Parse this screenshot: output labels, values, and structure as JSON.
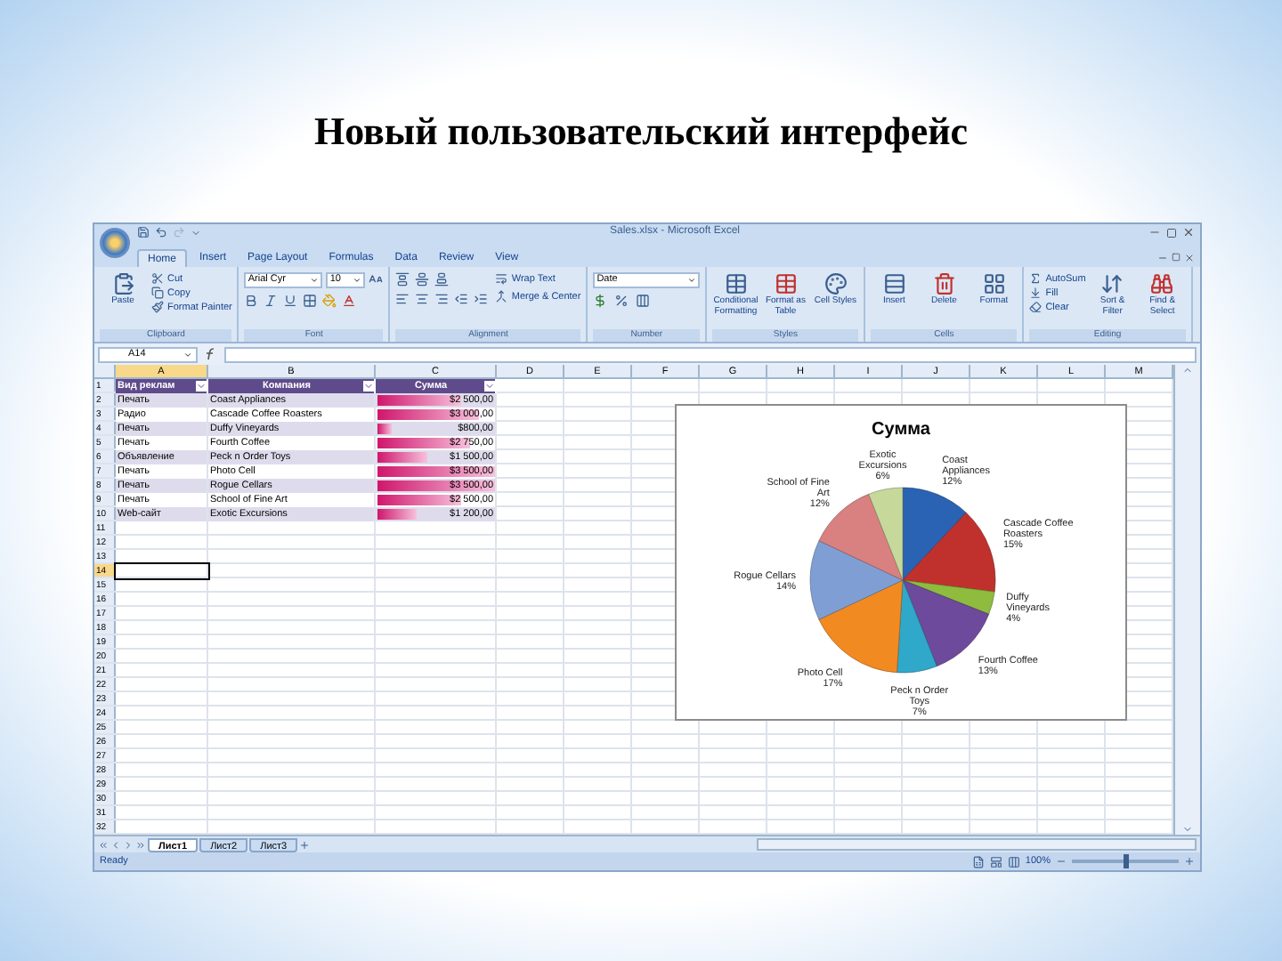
{
  "slide_title": "Новый пользовательский интерфейс",
  "window": {
    "title": "Sales.xlsx - Microsoft Excel"
  },
  "ribbon_tabs": [
    {
      "label": "Home",
      "selected": true
    },
    {
      "label": "Insert",
      "selected": false
    },
    {
      "label": "Page Layout",
      "selected": false
    },
    {
      "label": "Formulas",
      "selected": false
    },
    {
      "label": "Data",
      "selected": false
    },
    {
      "label": "Review",
      "selected": false
    },
    {
      "label": "View",
      "selected": false
    }
  ],
  "ribbon_groups": [
    {
      "label": "Clipboard",
      "kind": "clipboard",
      "large_buttons": [
        "Paste"
      ],
      "small_buttons": [
        "Cut",
        "Copy",
        "Format Painter"
      ]
    },
    {
      "label": "Font",
      "kind": "font",
      "fields": [
        "Arial Cyr",
        "10"
      ]
    },
    {
      "label": "Alignment",
      "kind": "alignment",
      "small_buttons": [
        "Wrap Text",
        "Merge & Center"
      ]
    },
    {
      "label": "Number",
      "kind": "number",
      "fields": [
        "Date"
      ]
    },
    {
      "label": "Styles",
      "kind": "buttons",
      "large_buttons": [
        "Conditional Formatting",
        "Format as Table",
        "Cell Styles"
      ]
    },
    {
      "label": "Cells",
      "kind": "buttons",
      "large_buttons": [
        "Insert",
        "Delete",
        "Format"
      ]
    },
    {
      "label": "Editing",
      "kind": "editing",
      "small_buttons": [
        "AutoSum",
        "Fill",
        "Clear"
      ],
      "large_buttons": [
        "Sort & Filter",
        "Find & Select"
      ]
    }
  ],
  "formula_bar": {
    "name_box": "A14"
  },
  "columns": [
    {
      "label": "A",
      "selected": true
    },
    {
      "label": "B",
      "selected": false
    },
    {
      "label": "C",
      "selected": false
    },
    {
      "label": "D",
      "selected": false
    },
    {
      "label": "E",
      "selected": false
    },
    {
      "label": "F",
      "selected": false
    },
    {
      "label": "G",
      "selected": false
    },
    {
      "label": "H",
      "selected": false
    },
    {
      "label": "I",
      "selected": false
    },
    {
      "label": "J",
      "selected": false
    },
    {
      "label": "K",
      "selected": false
    },
    {
      "label": "L",
      "selected": false
    },
    {
      "label": "M",
      "selected": false
    }
  ],
  "row_numbers": [
    {
      "label": "1",
      "selected": false
    },
    {
      "label": "2",
      "selected": false
    },
    {
      "label": "3",
      "selected": false
    },
    {
      "label": "4",
      "selected": false
    },
    {
      "label": "5",
      "selected": false
    },
    {
      "label": "6",
      "selected": false
    },
    {
      "label": "7",
      "selected": false
    },
    {
      "label": "8",
      "selected": false
    },
    {
      "label": "9",
      "selected": false
    },
    {
      "label": "10",
      "selected": false
    },
    {
      "label": "11",
      "selected": false
    },
    {
      "label": "12",
      "selected": false
    },
    {
      "label": "13",
      "selected": false
    },
    {
      "label": "14",
      "selected": true
    },
    {
      "label": "15",
      "selected": false
    },
    {
      "label": "16",
      "selected": false
    },
    {
      "label": "17",
      "selected": false
    },
    {
      "label": "18",
      "selected": false
    },
    {
      "label": "19",
      "selected": false
    },
    {
      "label": "20",
      "selected": false
    },
    {
      "label": "21",
      "selected": false
    },
    {
      "label": "22",
      "selected": false
    },
    {
      "label": "23",
      "selected": false
    },
    {
      "label": "24",
      "selected": false
    },
    {
      "label": "25",
      "selected": false
    },
    {
      "label": "26",
      "selected": false
    },
    {
      "label": "27",
      "selected": false
    },
    {
      "label": "28",
      "selected": false
    },
    {
      "label": "29",
      "selected": false
    },
    {
      "label": "30",
      "selected": false
    },
    {
      "label": "31",
      "selected": false
    },
    {
      "label": "32",
      "selected": false
    }
  ],
  "table": {
    "headers": [
      "Вид реклам",
      "Компания",
      "Сумма"
    ],
    "rows": [
      {
        "cells": [
          "Печать",
          "Coast Appliances",
          "$2 500,00"
        ],
        "level": 0.71
      },
      {
        "cells": [
          "Радио",
          "Cascade Coffee Roasters",
          "$3 000,00"
        ],
        "level": 0.86
      },
      {
        "cells": [
          "Печать",
          "Duffy Vineyards",
          "$800,00"
        ],
        "level": 0.12
      },
      {
        "cells": [
          "Печать",
          "Fourth Coffee",
          "$2 750,00"
        ],
        "level": 0.79
      },
      {
        "cells": [
          "Объявление",
          "Peck n Order Toys",
          "$1 500,00"
        ],
        "level": 0.43
      },
      {
        "cells": [
          "Печать",
          "Photo Cell",
          "$3 500,00"
        ],
        "level": 1
      },
      {
        "cells": [
          "Печать",
          "Rogue Cellars",
          "$3 500,00"
        ],
        "level": 1
      },
      {
        "cells": [
          "Печать",
          "School of Fine Art",
          "$2 500,00"
        ],
        "level": 0.71
      },
      {
        "cells": [
          "Web-сайт",
          "Exotic Excursions",
          "$1 200,00"
        ],
        "level": 0.34
      }
    ]
  },
  "chart": {
    "chart_data": {
      "type": "pie",
      "categories": [
        "Coast Appliances",
        "Cascade Coffee Roasters",
        "Duffy Vineyards",
        "Fourth Coffee",
        "Peck n Order Toys",
        "Photo Cell",
        "Rogue Cellars",
        "School of Fine Art",
        "Exotic Excursions"
      ],
      "series": [
        {
          "name": "Сумма",
          "values": [
            12,
            15,
            4,
            13,
            7,
            17,
            14,
            12,
            6
          ],
          "colors": [
            "#2a62b4",
            "#c0312e",
            "#8fbb3e",
            "#6d4a9c",
            "#30a8c9",
            "#f28a22",
            "#7f9fd4",
            "#d98080",
            "#c6d99b"
          ]
        }
      ],
      "value_labels": [
        "12%",
        "15%",
        "4%",
        "13%",
        "7%",
        "17%",
        "14%",
        "12%",
        "6%"
      ]
    }
  },
  "sheet_tabs": [
    {
      "label": "Лист1",
      "selected": true
    },
    {
      "label": "Лист2",
      "selected": false
    },
    {
      "label": "Лист3",
      "selected": false
    }
  ],
  "status_bar": {
    "text": "Ready",
    "zoom": "100%",
    "zoom_slider": {
      "level": 0.5
    }
  }
}
